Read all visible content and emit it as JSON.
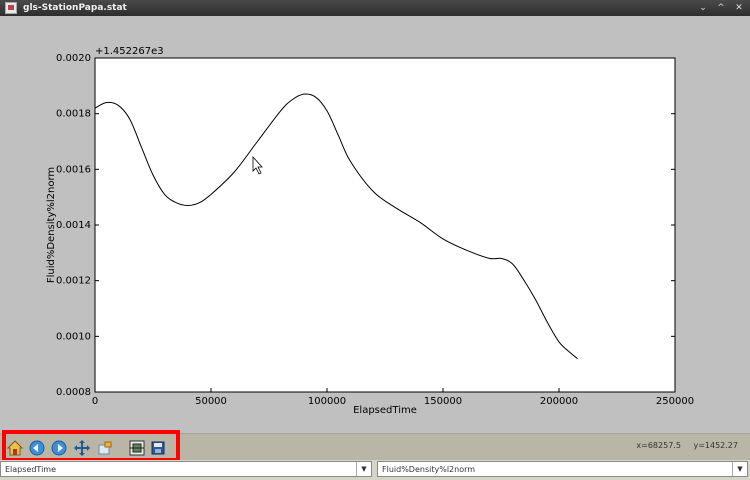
{
  "window": {
    "title": "gls-StationPapa.stat",
    "buttons": [
      "⌄",
      "^",
      "✕"
    ]
  },
  "chart_data": {
    "type": "line",
    "title": "",
    "offset_label": "+1.452267e3",
    "xlabel": "ElapsedTime",
    "ylabel": "Fluid%Density%l2norm",
    "xlim": [
      0,
      250000
    ],
    "ylim": [
      0.0008,
      0.002
    ],
    "xticks": [
      0,
      50000,
      100000,
      150000,
      200000,
      250000
    ],
    "xtick_labels": [
      "0",
      "50000",
      "100000",
      "150000",
      "200000",
      "250000"
    ],
    "yticks": [
      0.0008,
      0.001,
      0.0012,
      0.0014,
      0.0016,
      0.0018,
      0.002
    ],
    "ytick_labels": [
      "0.0008",
      "0.0010",
      "0.0012",
      "0.0014",
      "0.0016",
      "0.0018",
      "0.0020"
    ],
    "grid": false,
    "series": [
      {
        "x": [
          0,
          5000,
          10000,
          15000,
          20000,
          25000,
          30000,
          35000,
          40000,
          45000,
          50000,
          60000,
          70000,
          80000,
          85000,
          90000,
          95000,
          100000,
          105000,
          110000,
          120000,
          130000,
          140000,
          150000,
          160000,
          170000,
          175000,
          180000,
          185000,
          190000,
          195000,
          200000,
          205000,
          208000
        ],
        "y": [
          0.00182,
          0.00184,
          0.00183,
          0.00178,
          0.00168,
          0.00158,
          0.00151,
          0.00148,
          0.00147,
          0.00148,
          0.00151,
          0.00159,
          0.0017,
          0.00181,
          0.00185,
          0.00187,
          0.00186,
          0.00181,
          0.00172,
          0.00163,
          0.00152,
          0.00146,
          0.00141,
          0.00135,
          0.00131,
          0.00128,
          0.00128,
          0.00126,
          0.0012,
          0.00113,
          0.00105,
          0.00098,
          0.00094,
          0.00092
        ]
      }
    ]
  },
  "toolbar": {
    "items": [
      {
        "name": "home-icon",
        "label": "Home"
      },
      {
        "name": "back-icon",
        "label": "Back"
      },
      {
        "name": "forward-icon",
        "label": "Forward"
      },
      {
        "name": "pan-icon",
        "label": "Pan"
      },
      {
        "name": "zoom-icon",
        "label": "Zoom"
      },
      {
        "name": "configure-subplots-icon",
        "label": "Subplots"
      },
      {
        "name": "save-icon",
        "label": "Save"
      }
    ],
    "x_readout": "x=68257.5",
    "y_readout": "y=1452.27"
  },
  "selectors": {
    "x_field": "ElapsedTime",
    "y_field": "Fluid%Density%l2norm"
  },
  "colors": {
    "highlight": "#ff0000",
    "line": "#000000"
  }
}
